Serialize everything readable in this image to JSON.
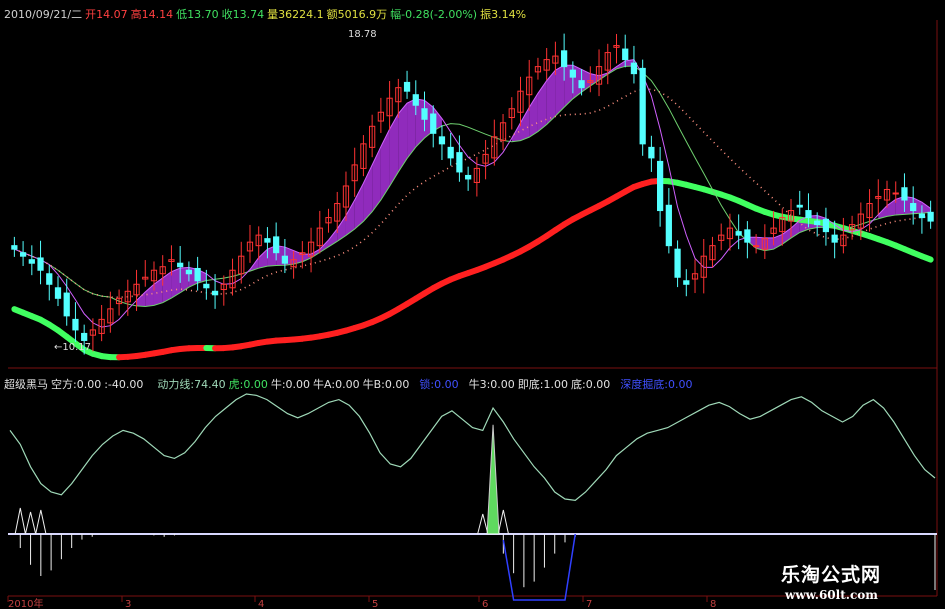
{
  "header": {
    "date": "2010/09/21/二",
    "open_label": "开",
    "open_value": "14.07",
    "high_label": "高",
    "high_value": "14.14",
    "low_label": "低",
    "low_value": "13.70",
    "close_label": "收",
    "close_value": "13.74",
    "volume_label": "量",
    "volume_value": "36224.1",
    "amount_label": "额",
    "amount_value": "5016.9万",
    "change_label": "幅",
    "change_value": "-0.28(-2.00%)",
    "amplitude_label": "振",
    "amplitude_value": "3.14%"
  },
  "indicator": {
    "name": "超级黑马",
    "empty_label": "空方:",
    "empty_value": "0.00",
    "neg_value": ":-40.00",
    "power_label": "动力线:",
    "power_value": "74.40",
    "tiger_label": "虎:",
    "tiger_value": "0.00",
    "bull_label": "牛:",
    "bull_value": "0.00",
    "bullA_label": "牛A:",
    "bullA_value": "0.00",
    "bullB_label": "牛B:",
    "bullB_value": "0.00",
    "lock_label": "锁:",
    "lock_value": "0.00",
    "bull3_label": "牛3:",
    "bull3_value": "0.00",
    "instant_label": "即底:",
    "instant_value": "1.00",
    "bottom_label": "底:",
    "bottom_value": "0.00",
    "deep_label": "深度掘底:",
    "deep_value": "0.00"
  },
  "annotations": {
    "high_mark": "18.78",
    "low_mark": "←10.17"
  },
  "x_axis": {
    "labels": [
      "2010年",
      "3",
      "4",
      "5",
      "6",
      "7",
      "8"
    ]
  },
  "watermark": {
    "site_name": "乐淘公式网",
    "site_url": "www.60lt.com"
  },
  "colors": {
    "bg": "#000000",
    "up": "#ff3333",
    "down": "#54ffff",
    "ma_red": "#ff2020",
    "ma_green": "#40ff60",
    "fill_purple": "#a030d0",
    "fill_green": "#70ff70",
    "osc_line": "#9fd9b8"
  },
  "chart_data": [
    {
      "type": "candlestick",
      "title": "",
      "xlabel": "",
      "ylabel": "",
      "ylim": [
        9.8,
        19.2
      ],
      "x": [
        "2010年",
        "3",
        "4",
        "5",
        "6",
        "7",
        "8"
      ],
      "annotations": [
        {
          "text": "18.78",
          "kind": "high"
        },
        {
          "text": "10.17",
          "kind": "low"
        }
      ],
      "series": [
        {
          "values": [
            12.9,
            12.7,
            12.5,
            12.3,
            11.9,
            11.5,
            11.0,
            10.6,
            10.3,
            10.6,
            10.9,
            11.2,
            11.5,
            11.7,
            11.9,
            12.1,
            12.3,
            12.4,
            12.6,
            12.4,
            12.2,
            12.0,
            11.8,
            11.6,
            11.9,
            12.3,
            12.7,
            13.1,
            13.3,
            13.1,
            12.8,
            12.5,
            12.6,
            12.8,
            13.1,
            13.5,
            13.8,
            14.2,
            14.7,
            15.3,
            15.9,
            16.4,
            16.8,
            17.2,
            17.5,
            17.4,
            17.0,
            16.6,
            16.2,
            15.9,
            15.5,
            15.1,
            14.9,
            15.2,
            15.6,
            16.1,
            16.5,
            16.9,
            17.4,
            17.8,
            18.1,
            18.3,
            18.4,
            18.1,
            17.8,
            17.5,
            17.7,
            18.1,
            18.5,
            18.7,
            18.3,
            17.9,
            15.9,
            15.5,
            14.0,
            13.0,
            12.1,
            11.9,
            12.2,
            12.7,
            13.0,
            13.3,
            13.5,
            13.3,
            13.1,
            13.0,
            13.2,
            13.5,
            13.8,
            14.0,
            14.1,
            13.8,
            13.6,
            13.4,
            13.1,
            13.3,
            13.6,
            13.9,
            14.2,
            14.4,
            14.6,
            14.5,
            14.3,
            14.0,
            13.8,
            13.7
          ]
        }
      ]
    },
    {
      "type": "line",
      "title": "超级黑马",
      "x": [
        "2010年",
        "3",
        "4",
        "5",
        "6",
        "7",
        "8"
      ],
      "series": [
        {
          "name": "动力线",
          "values": [
            74,
            64,
            48,
            36,
            30,
            28,
            36,
            46,
            56,
            64,
            70,
            74,
            72,
            68,
            62,
            56,
            54,
            58,
            66,
            76,
            84,
            90,
            96,
            100,
            99,
            96,
            91,
            86,
            83,
            86,
            90,
            94,
            96,
            92,
            84,
            72,
            58,
            50,
            48,
            54,
            64,
            74,
            84,
            88,
            82,
            76,
            74,
            90,
            80,
            68,
            58,
            48,
            40,
            30,
            25,
            24,
            30,
            38,
            46,
            56,
            62,
            68,
            72,
            74,
            76,
            80,
            84,
            88,
            92,
            94,
            91,
            86,
            82,
            84,
            88,
            92,
            96,
            98,
            94,
            88,
            84,
            80,
            84,
            92,
            96,
            90,
            80,
            68,
            56,
            46,
            40
          ]
        },
        {
          "name": "空方",
          "values": [
            0,
            -10,
            -22,
            -30,
            -26,
            -18,
            -10,
            -4,
            -2,
            0,
            0,
            0,
            0,
            0,
            -1,
            -2,
            -1,
            0,
            0,
            0,
            0,
            0,
            0,
            0,
            0,
            0,
            0,
            0,
            0,
            0,
            0,
            0,
            0,
            0,
            0,
            0,
            0,
            0,
            0,
            0,
            0,
            0,
            0,
            0,
            0,
            0,
            0,
            0,
            -14,
            -28,
            -38,
            -34,
            -24,
            -14,
            -6,
            -2,
            0,
            0,
            0,
            0,
            0,
            0,
            0,
            0,
            0,
            0,
            0,
            0,
            0,
            0,
            0,
            0,
            0,
            0,
            0,
            0,
            0,
            0,
            0,
            0,
            0,
            0,
            0,
            0,
            0,
            0,
            0,
            0,
            0,
            0,
            -40
          ]
        }
      ]
    }
  ]
}
